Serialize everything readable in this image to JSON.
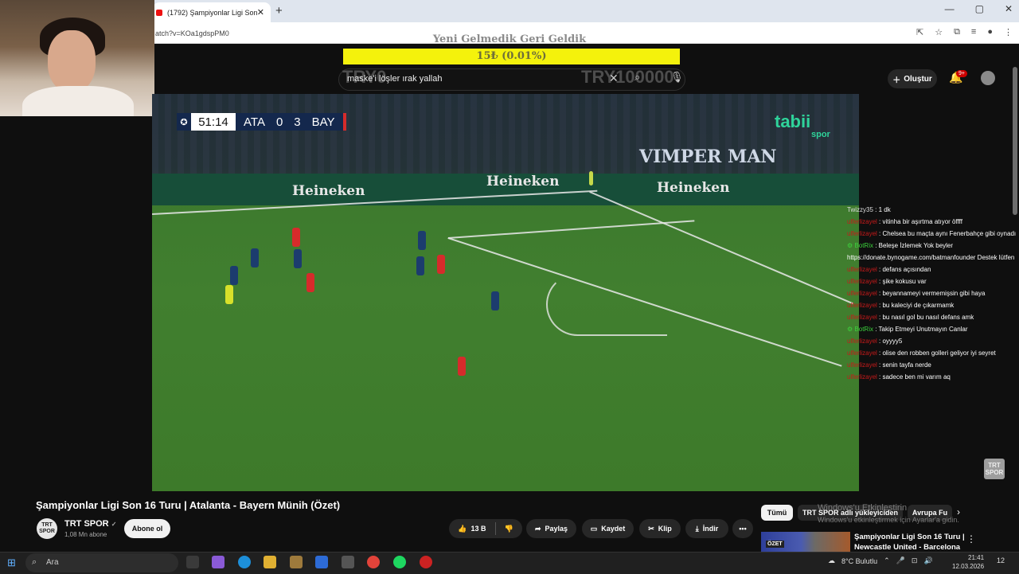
{
  "browser": {
    "tab_title": "(1792) Şampiyonlar Ligi Son",
    "tab_close": "✕",
    "new_tab": "+",
    "url": "atch?v=KOa1gdspPM0",
    "window_controls": [
      "—",
      "▢",
      "✕"
    ]
  },
  "donation": {
    "title": "Yeni Gelmedik Geri Geldik",
    "progress_text": "15₺ (0.01%)",
    "progress_fraction": 0.0001,
    "goal_left": "TRY0",
    "goal_right": "TRY100000"
  },
  "youtube": {
    "search_value": "maske'i löşler ırak yallah",
    "create_label": "Oluştur",
    "notif_badge": "9+"
  },
  "match": {
    "clock": "51:14",
    "home": "ATA",
    "home_score": "0",
    "away_score": "3",
    "away": "BAY",
    "broadcaster": "tabii",
    "broadcaster_sub": "spor",
    "ads": [
      "Heineken",
      "Heineken",
      "Heineken"
    ],
    "banner": "VIMPER MAN"
  },
  "chat": [
    {
      "user": "Twizzy35",
      "msg": "1 dk",
      "style": "w",
      "icon": ""
    },
    {
      "user": "ulferlizayel",
      "msg": "vitinha bir aşırtma atıyor öffff",
      "style": "r",
      "icon": ""
    },
    {
      "user": "ulferlizayel",
      "msg": "Chelsea bu maçta aynı Fenerbahçe gibi oynadı",
      "style": "r",
      "icon": ""
    },
    {
      "user": "BotRix",
      "msg": "Beleşe İzlemek Yok beyler",
      "style": "g",
      "icon": "⚙"
    },
    {
      "user": "",
      "msg": "https://donate.bynogame.com/batmanfounder Destek lütfen",
      "style": "w",
      "icon": ""
    },
    {
      "user": "ulferlizayel",
      "msg": "defans açısından",
      "style": "r",
      "icon": ""
    },
    {
      "user": "ulferlizayel",
      "msg": "şike kokusu var",
      "style": "r",
      "icon": ""
    },
    {
      "user": "ulferlizayel",
      "msg": "beyannameyi vermemişsin gibi haya",
      "style": "r",
      "icon": ""
    },
    {
      "user": "ulferlizayel",
      "msg": "bu kaleciyi de çıkarmamk",
      "style": "r",
      "icon": ""
    },
    {
      "user": "ulferlizayel",
      "msg": "bu nasıl gol bu nasıl defans amk",
      "style": "r",
      "icon": ""
    },
    {
      "user": "BotRix",
      "msg": "Takip Etmeyi Unutmayın Canlar",
      "style": "g",
      "icon": "⚙"
    },
    {
      "user": "ulferlizayel",
      "msg": "oyyyy5",
      "style": "r",
      "icon": ""
    },
    {
      "user": "ulferlizayel",
      "msg": "olise den robben golleri geliyor iyi seyret",
      "style": "r",
      "icon": ""
    },
    {
      "user": "ulferlizayel",
      "msg": "senin tayfa nerde",
      "style": "r",
      "icon": ""
    },
    {
      "user": "ulferlizayel",
      "msg": "sadece ben mi varım aq",
      "style": "r",
      "icon": ""
    }
  ],
  "video": {
    "title": "Şampiyonlar Ligi Son 16 Turu | Atalanta - Bayern Münih (Özet)",
    "channel": "TRT SPOR",
    "verified": "✓",
    "subscribers": "1,08 Mn abone",
    "subscribe_label": "Abone ol",
    "channel_logo": "TRT\nSPOR",
    "likes": "13 B",
    "share_label": "Paylaş",
    "save_label": "Kaydet",
    "clip_label": "Klip",
    "download_label": "İndir",
    "more_label": "•••",
    "trt_badge": "TRT\nSPOR"
  },
  "recommendations": {
    "chips": [
      "Tümü",
      "TRT SPOR adlı yükleyiciden",
      "Avrupa Fu"
    ],
    "next_video_title": "Şampiyonlar Ligi Son 16 Turu | Newcastle United - Barcelona ...",
    "thumb_badge": "ÖZET",
    "windows_activation_title": "Windows'u Etkinleştirin",
    "windows_activation_sub": "Windows'u etkinleştirmek için Ayarlar'a gidin."
  },
  "taskbar": {
    "search_placeholder": "Ara",
    "weather": "8°C Bulutlu",
    "time": "21:41",
    "date": "12.03.2026",
    "notif_count": "12"
  },
  "colors": {
    "accent": "#cc0000",
    "progress": "#f4f20c",
    "chat_user": "#c61a1a",
    "bot": "#3cd23c"
  }
}
